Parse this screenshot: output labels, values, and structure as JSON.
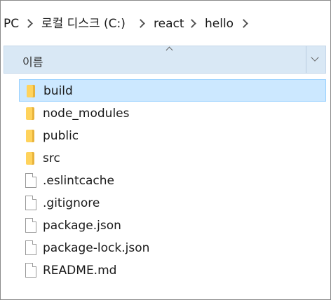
{
  "breadcrumb": {
    "items": [
      "PC",
      "로컬 디스크 (C:)",
      "react",
      "hello"
    ]
  },
  "column_header": {
    "name_label": "이름"
  },
  "files": [
    {
      "name": "build",
      "type": "folder",
      "selected": true
    },
    {
      "name": "node_modules",
      "type": "folder",
      "selected": false
    },
    {
      "name": "public",
      "type": "folder",
      "selected": false
    },
    {
      "name": "src",
      "type": "folder",
      "selected": false
    },
    {
      "name": ".eslintcache",
      "type": "file",
      "selected": false
    },
    {
      "name": ".gitignore",
      "type": "file",
      "selected": false
    },
    {
      "name": "package.json",
      "type": "file",
      "selected": false
    },
    {
      "name": "package-lock.json",
      "type": "file",
      "selected": false
    },
    {
      "name": "README.md",
      "type": "file",
      "selected": false
    }
  ],
  "colors": {
    "selection_background": "#cce8ff",
    "header_background": "#d9e8f5",
    "folder_yellow": "#ffd35c"
  },
  "icons": {
    "folder": "folder-icon",
    "file": "file-icon",
    "separator": "chevron-right-icon"
  }
}
